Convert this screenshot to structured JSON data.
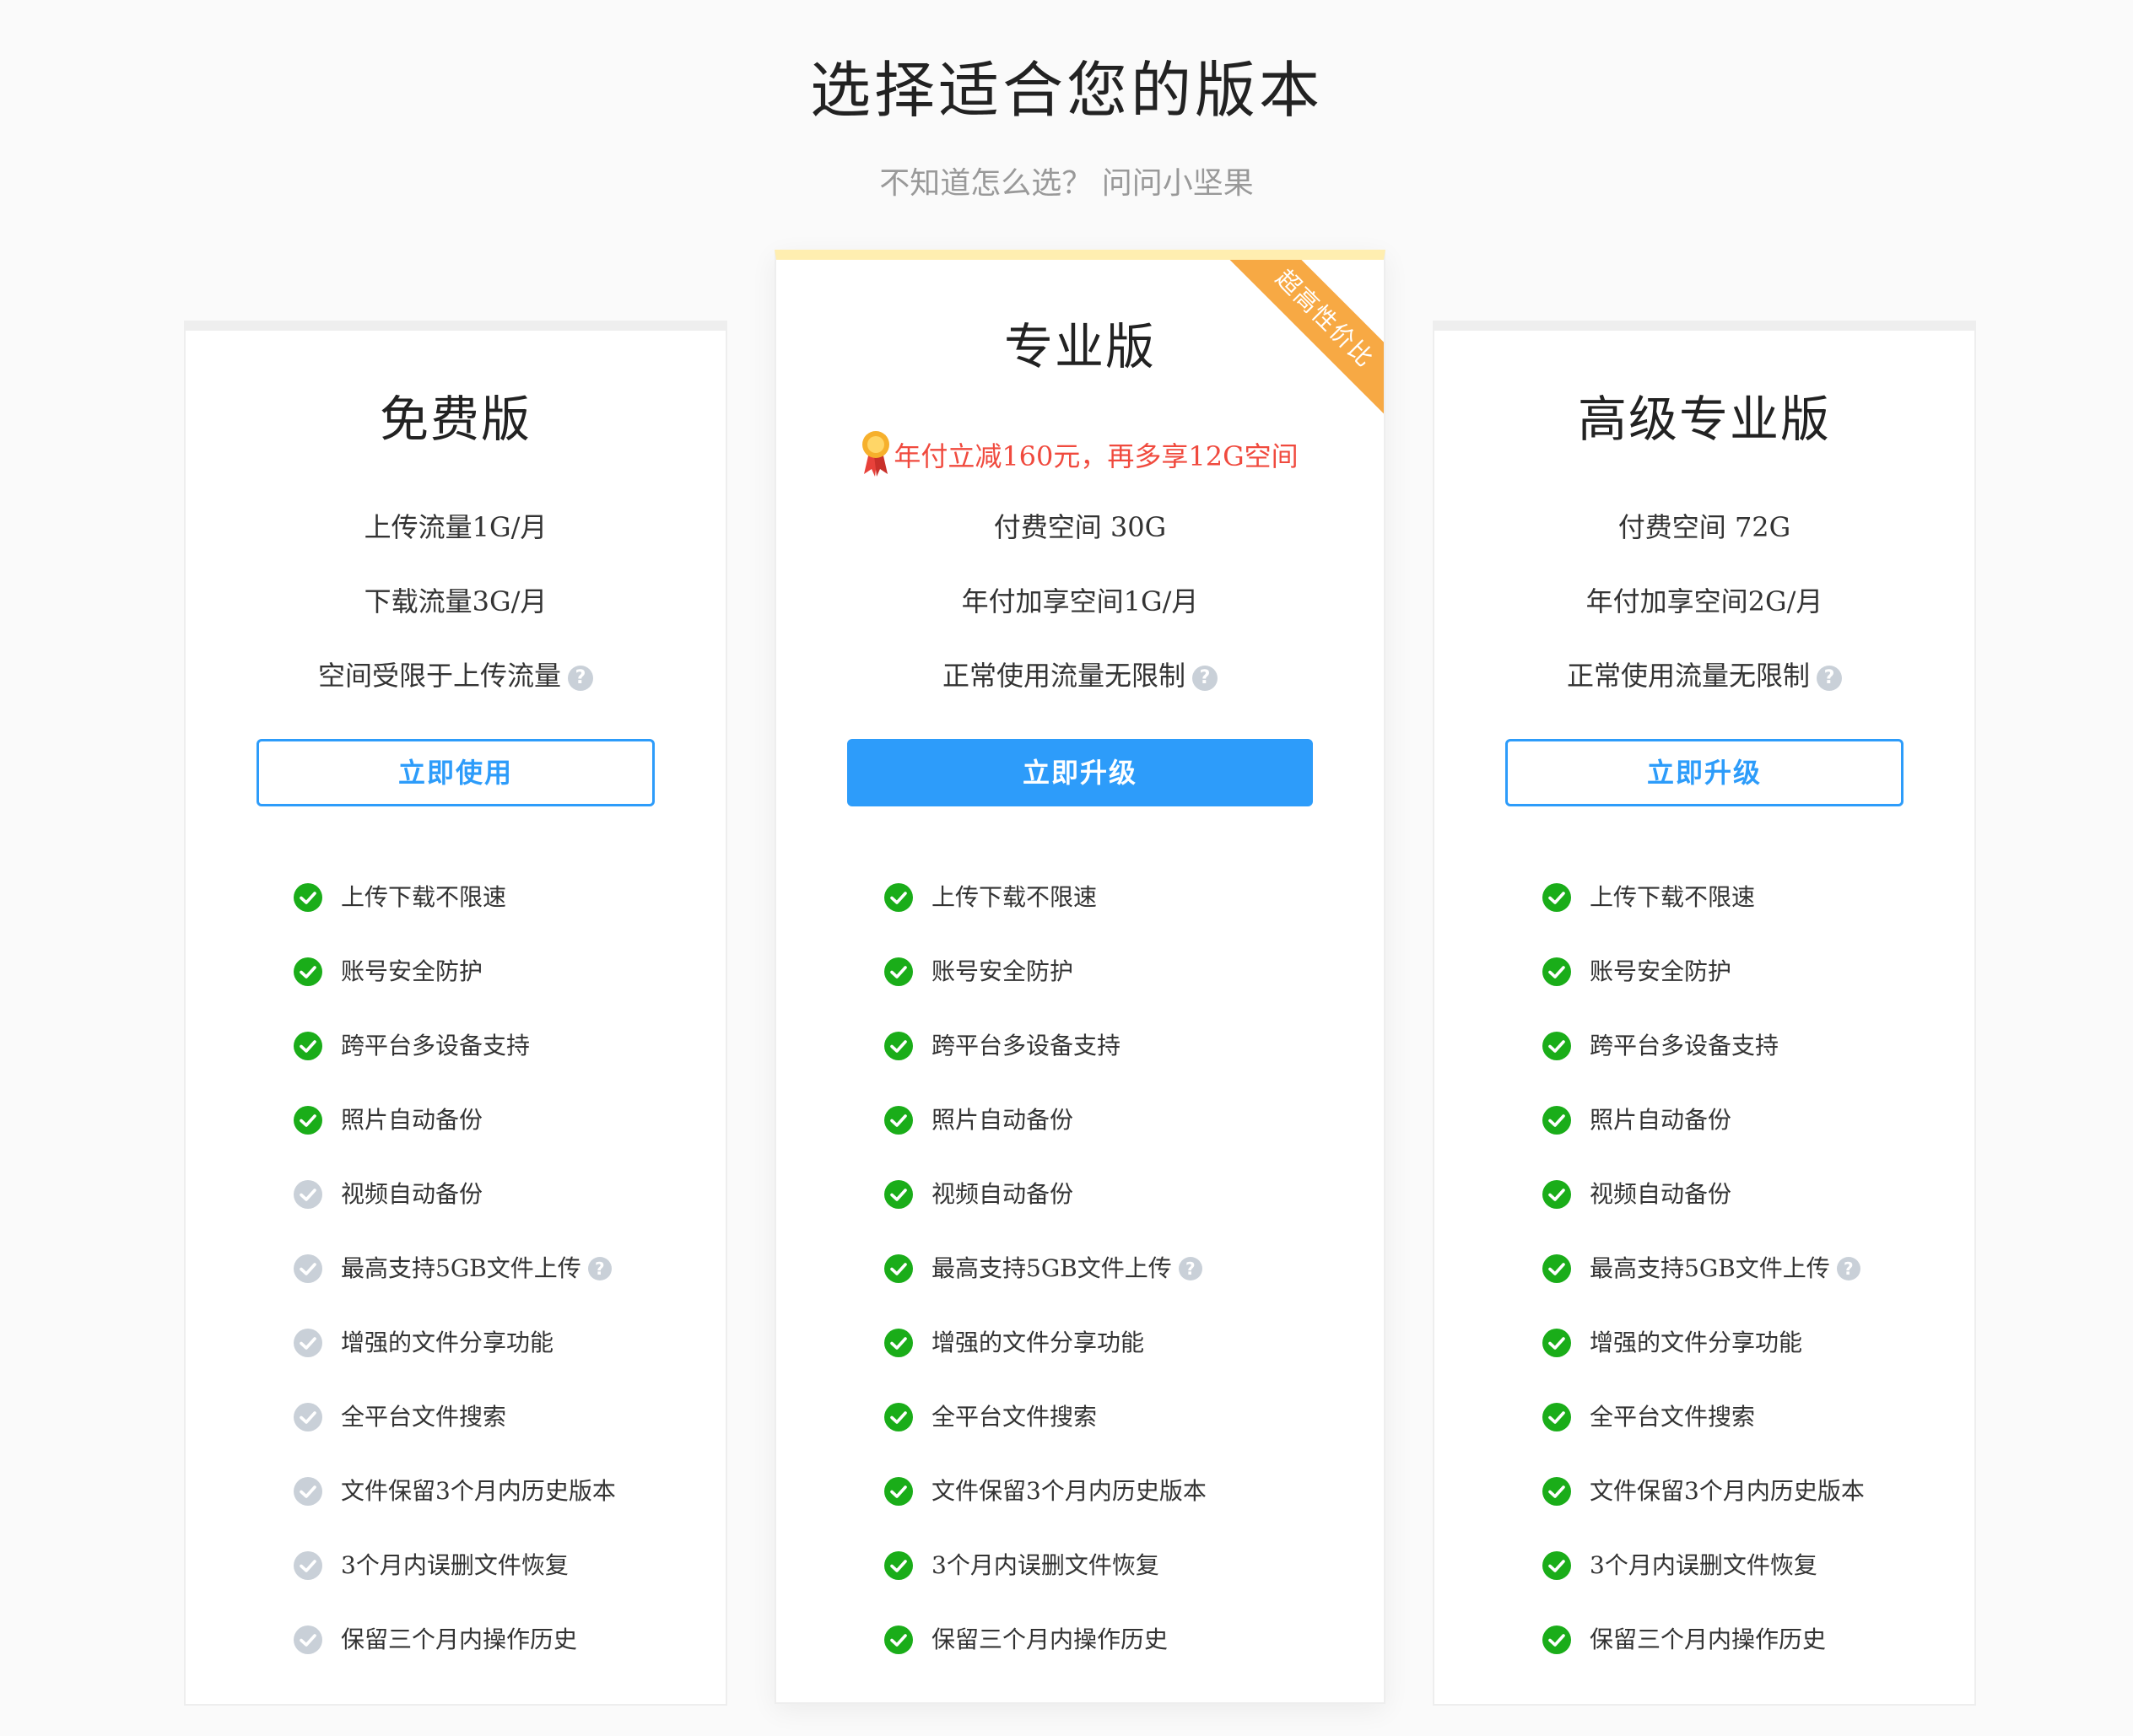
{
  "header": {
    "title": "选择适合您的版本",
    "subtitle": "不知道怎么选？ 问问小坚果"
  },
  "plans": [
    {
      "name": "免费版",
      "lines": [
        "上传流量1G/月",
        "下载流量3G/月",
        "空间受限于上传流量"
      ],
      "button": "立即使用",
      "features": [
        {
          "label": "上传下载不限速",
          "enabled": true
        },
        {
          "label": "账号安全防护",
          "enabled": true
        },
        {
          "label": "跨平台多设备支持",
          "enabled": true
        },
        {
          "label": "照片自动备份",
          "enabled": true
        },
        {
          "label": "视频自动备份",
          "enabled": false
        },
        {
          "label": "最高支持5GB文件上传",
          "enabled": false
        },
        {
          "label": "增强的文件分享功能",
          "enabled": false
        },
        {
          "label": "全平台文件搜索",
          "enabled": false
        },
        {
          "label": "文件保留3个月内历史版本",
          "enabled": false
        },
        {
          "label": "3个月内误删文件恢复",
          "enabled": false
        },
        {
          "label": "保留三个月内操作历史",
          "enabled": false
        }
      ]
    },
    {
      "name": "专业版",
      "ribbon": "超高性价比",
      "promo": "年付立减160元，再多享12G空间",
      "lines": [
        "付费空间 30G",
        "年付加享空间1G/月",
        "正常使用流量无限制"
      ],
      "button": "立即升级",
      "features": [
        {
          "label": "上传下载不限速",
          "enabled": true
        },
        {
          "label": "账号安全防护",
          "enabled": true
        },
        {
          "label": "跨平台多设备支持",
          "enabled": true
        },
        {
          "label": "照片自动备份",
          "enabled": true
        },
        {
          "label": "视频自动备份",
          "enabled": true
        },
        {
          "label": "最高支持5GB文件上传",
          "enabled": true
        },
        {
          "label": "增强的文件分享功能",
          "enabled": true
        },
        {
          "label": "全平台文件搜索",
          "enabled": true
        },
        {
          "label": "文件保留3个月内历史版本",
          "enabled": true
        },
        {
          "label": "3个月内误删文件恢复",
          "enabled": true
        },
        {
          "label": "保留三个月内操作历史",
          "enabled": true
        }
      ]
    },
    {
      "name": "高级专业版",
      "lines": [
        "付费空间 72G",
        "年付加享空间2G/月",
        "正常使用流量无限制"
      ],
      "button": "立即升级",
      "features": [
        {
          "label": "上传下载不限速",
          "enabled": true
        },
        {
          "label": "账号安全防护",
          "enabled": true
        },
        {
          "label": "跨平台多设备支持",
          "enabled": true
        },
        {
          "label": "照片自动备份",
          "enabled": true
        },
        {
          "label": "视频自动备份",
          "enabled": true
        },
        {
          "label": "最高支持5GB文件上传",
          "enabled": true
        },
        {
          "label": "增强的文件分享功能",
          "enabled": true
        },
        {
          "label": "全平台文件搜索",
          "enabled": true
        },
        {
          "label": "文件保留3个月内历史版本",
          "enabled": true
        },
        {
          "label": "3个月内误删文件恢复",
          "enabled": true
        },
        {
          "label": "保留三个月内操作历史",
          "enabled": true
        }
      ]
    }
  ],
  "colors": {
    "accent": "#2d9cfa",
    "check_enabled": "#1aad19",
    "check_disabled": "#c9d0d8",
    "promo": "#f04a3e",
    "ribbon": "#f7a944"
  },
  "icons": {
    "check": "check-circle-icon",
    "help": "question-circle-icon",
    "medal": "medal-icon"
  }
}
